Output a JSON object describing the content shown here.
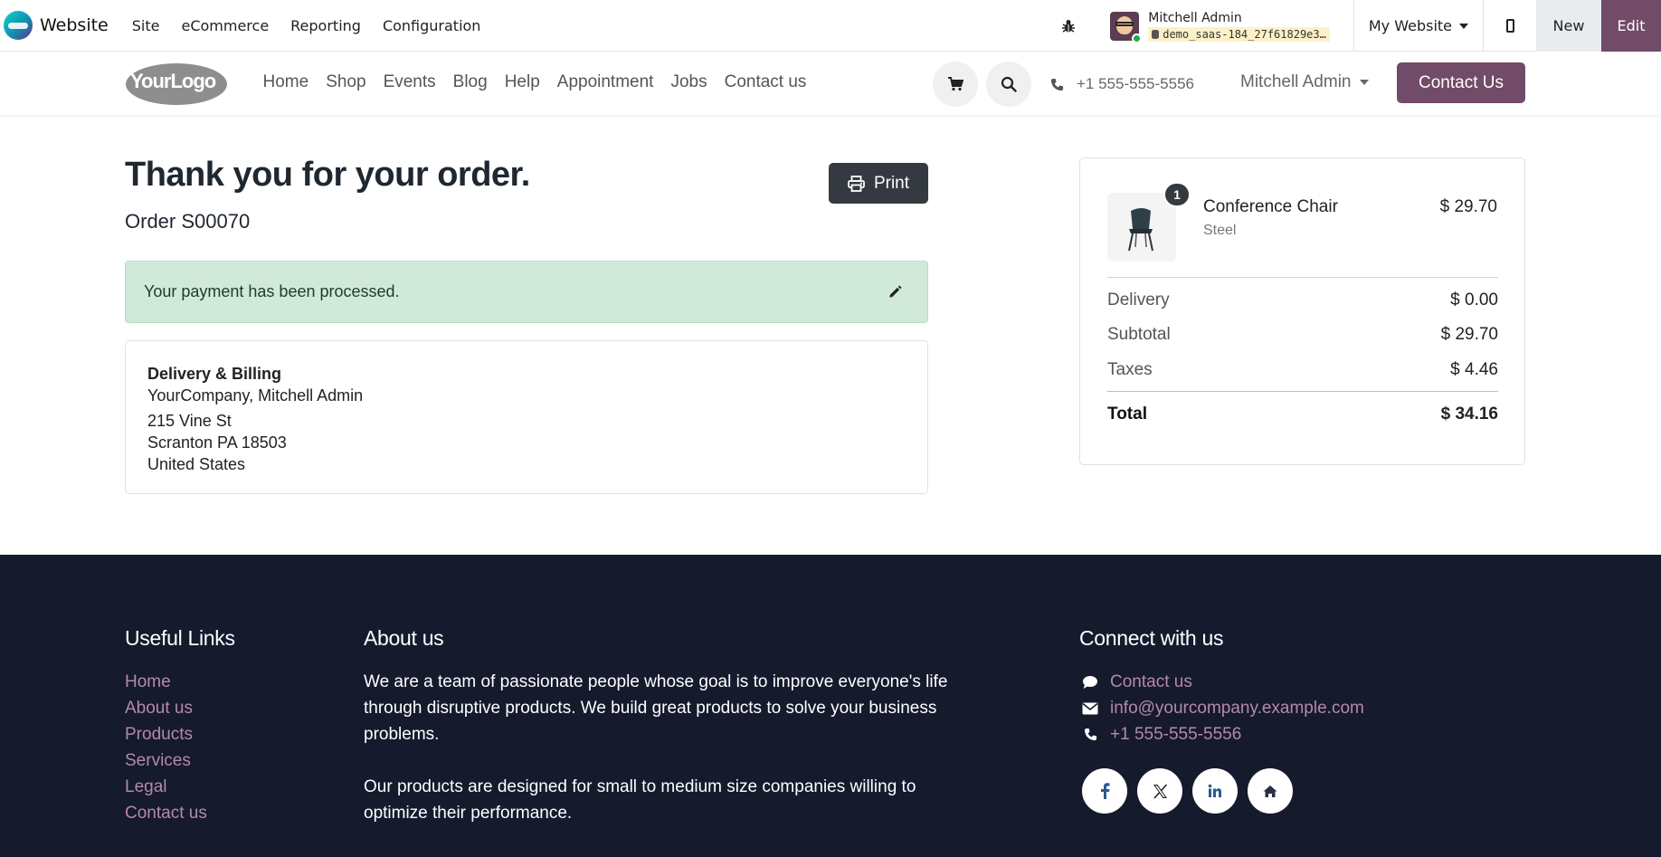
{
  "adminbar": {
    "app_name": "Website",
    "menu": [
      "Site",
      "eCommerce",
      "Reporting",
      "Configuration"
    ],
    "user_name": "Mitchell Admin",
    "database": "demo_saas-184_27f61829e3…",
    "website_selector": "My Website",
    "new_label": "New",
    "edit_label": "Edit"
  },
  "header": {
    "logo_text": "YourLogo",
    "nav": [
      "Home",
      "Shop",
      "Events",
      "Blog",
      "Help",
      "Appointment",
      "Jobs",
      "Contact us"
    ],
    "phone": "+1 555-555-5556",
    "user": "Mitchell Admin",
    "contact_button": "Contact Us"
  },
  "confirmation": {
    "title": "Thank you for your order.",
    "order": "Order S00070",
    "print_label": "Print",
    "payment_message": "Your payment has been processed."
  },
  "address": {
    "title": "Delivery & Billing",
    "name": "YourCompany, Mitchell Admin",
    "street": "215 Vine St",
    "city": "Scranton PA 18503",
    "country": "United States"
  },
  "summary": {
    "item": {
      "qty": "1",
      "name": "Conference Chair",
      "variant": "Steel",
      "price": "$ 29.70"
    },
    "delivery_label": "Delivery",
    "delivery_value": "$ 0.00",
    "subtotal_label": "Subtotal",
    "subtotal_value": "$ 29.70",
    "taxes_label": "Taxes",
    "taxes_value": "$ 4.46",
    "total_label": "Total",
    "total_value": "$ 34.16"
  },
  "footer": {
    "links_title": "Useful Links",
    "links": [
      "Home",
      "About us",
      "Products",
      "Services",
      "Legal",
      "Contact us"
    ],
    "about_title": "About us",
    "about_p1": "We are a team of passionate people whose goal is to improve everyone's life through disruptive products. We build great products to solve your business problems.",
    "about_p2": "Our products are designed for small to medium size companies willing to optimize their performance.",
    "connect_title": "Connect with us",
    "contact_link": "Contact us",
    "email": "info@yourcompany.example.com",
    "phone": "+1 555-555-5556",
    "socials": [
      "facebook-icon",
      "x-icon",
      "linkedin-icon",
      "home-icon"
    ]
  },
  "colors": {
    "brand": "#714b67",
    "footer_bg": "#151a2d",
    "footer_link": "#b58aa5",
    "success_bg": "#d1e9d9"
  }
}
